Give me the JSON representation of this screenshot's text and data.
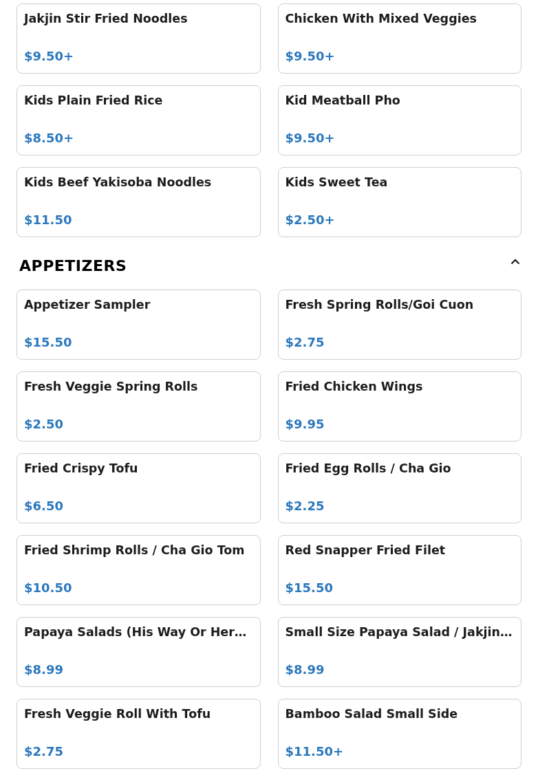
{
  "sections": [
    {
      "items": [
        {
          "name": "Jakjin Stir Fried Noodles",
          "price": "$9.50+"
        },
        {
          "name": "Chicken With Mixed Veggies",
          "price": "$9.50+"
        },
        {
          "name": "Kids Plain Fried Rice",
          "price": "$8.50+"
        },
        {
          "name": "Kid Meatball Pho",
          "price": "$9.50+"
        },
        {
          "name": "Kids Beef Yakisoba Noodles",
          "price": "$11.50"
        },
        {
          "name": "Kids Sweet Tea",
          "price": "$2.50+"
        }
      ]
    },
    {
      "title": "APPETIZERS",
      "expanded": true,
      "items": [
        {
          "name": "Appetizer Sampler",
          "price": "$15.50"
        },
        {
          "name": "Fresh Spring Rolls/Goi Cuon",
          "price": "$2.75"
        },
        {
          "name": "Fresh Veggie Spring Rolls",
          "price": "$2.50"
        },
        {
          "name": "Fried Chicken Wings",
          "price": "$9.95"
        },
        {
          "name": "Fried Crispy Tofu",
          "price": "$6.50"
        },
        {
          "name": "Fried Egg Rolls / Cha Gio",
          "price": "$2.25"
        },
        {
          "name": "Fried Shrimp Rolls / Cha Gio Tom",
          "price": "$10.50"
        },
        {
          "name": "Red Snapper Fried Filet",
          "price": "$15.50"
        },
        {
          "name": "Papaya Salads (His Way Or Her…",
          "price": "$8.99"
        },
        {
          "name": "Small Size Papaya Salad / Jakjin…",
          "price": "$8.99"
        },
        {
          "name": "Fresh Veggie Roll With Tofu",
          "price": "$2.75"
        },
        {
          "name": "Bamboo Salad Small Side",
          "price": "$11.50+"
        }
      ]
    }
  ]
}
